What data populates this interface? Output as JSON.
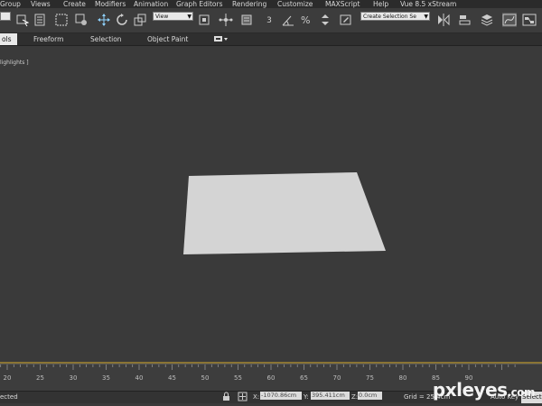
{
  "menubar": {
    "items": [
      "Group",
      "Views",
      "Create",
      "Modifiers",
      "Animation",
      "Graph Editors",
      "Rendering",
      "Customize",
      "MAXScript",
      "Help",
      "Vue 8.5 xStream"
    ]
  },
  "toolbar": {
    "reference_dropdown": "View",
    "snap_label": "3",
    "selection_set_dropdown": "Create Selection Se",
    "icons": [
      "select-icon",
      "select-region-icon",
      "window-crossing-icon",
      "move-icon",
      "rotate-icon",
      "scale-icon",
      "pivot-icon",
      "snap-icon",
      "angle-snap-icon",
      "percent-snap-icon",
      "spinner-snap-icon",
      "edit-named-selection-icon",
      "mirror-icon",
      "align-icon",
      "layer-icon",
      "curve-editor-icon",
      "schematic-icon",
      "material-editor-icon"
    ]
  },
  "ribbon": {
    "tabs": [
      "ols",
      "Freeform",
      "Selection",
      "Object Paint"
    ]
  },
  "viewport": {
    "label": "lighlights ]"
  },
  "ruler": {
    "ticks": [
      "20",
      "25",
      "30",
      "35",
      "40",
      "45",
      "50",
      "55",
      "60",
      "65",
      "70",
      "75",
      "80",
      "85",
      "90"
    ]
  },
  "statusbar": {
    "left_text": "ected",
    "x_label": "X:",
    "x_value": "-1070.86cm",
    "y_label": "Y:",
    "y_value": "395.411cm",
    "z_label": "Z:",
    "z_value": "0.0cm",
    "grid": "Grid = 25.4cm",
    "auto_key": "Auto Key",
    "selected": "Selecte"
  },
  "watermark": {
    "name": "pxleyes",
    "tld": ".com"
  }
}
